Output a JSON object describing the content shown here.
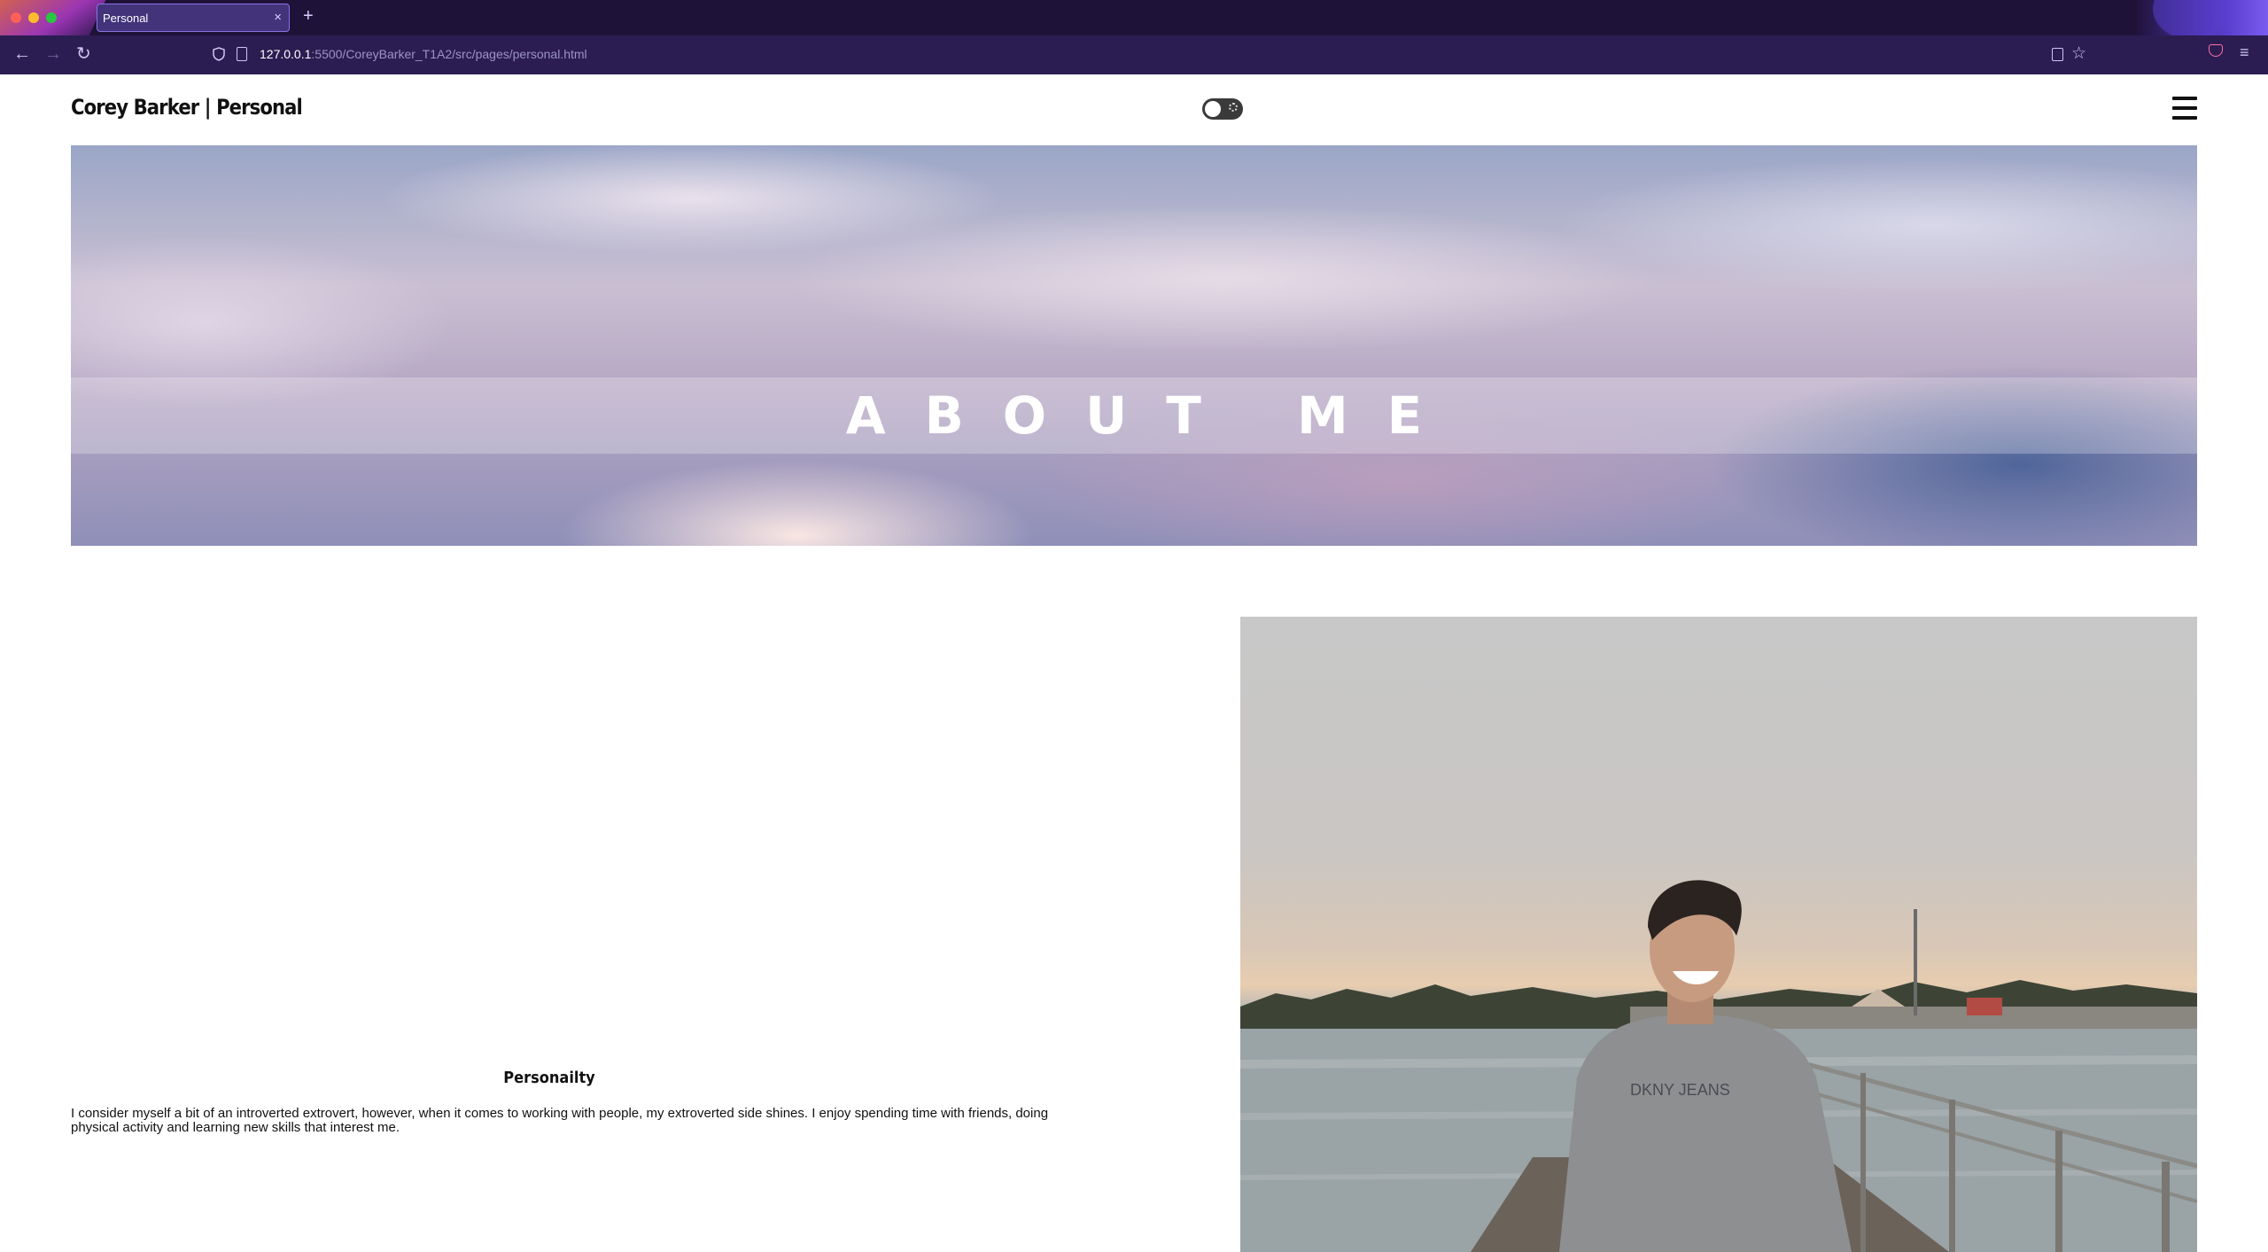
{
  "browser": {
    "tab_title": "Personal",
    "tab_close": "×",
    "new_tab": "+",
    "url_host": "127.0.0.1",
    "url_rest": ":5500/CoreyBarker_T1A2/src/pages/personal.html",
    "back": "←",
    "forward": "→",
    "reload": "↻",
    "star": "☆",
    "menu": "≡"
  },
  "header": {
    "site_title": "Corey Barker | Personal",
    "theme_toggle_icon": "sun-icon",
    "menu_icon": "hamburger-icon"
  },
  "hero": {
    "title": "ABOUT ME"
  },
  "personality": {
    "heading": "Personailty",
    "text": "I consider myself a bit of an introverted extrovert, however, when it comes to working with people, my extroverted side shines. I enjoy spending time with friends, doing physical activity and learning new skills that interest me."
  },
  "photo": {
    "shirt_text": "DKNY JEANS"
  }
}
